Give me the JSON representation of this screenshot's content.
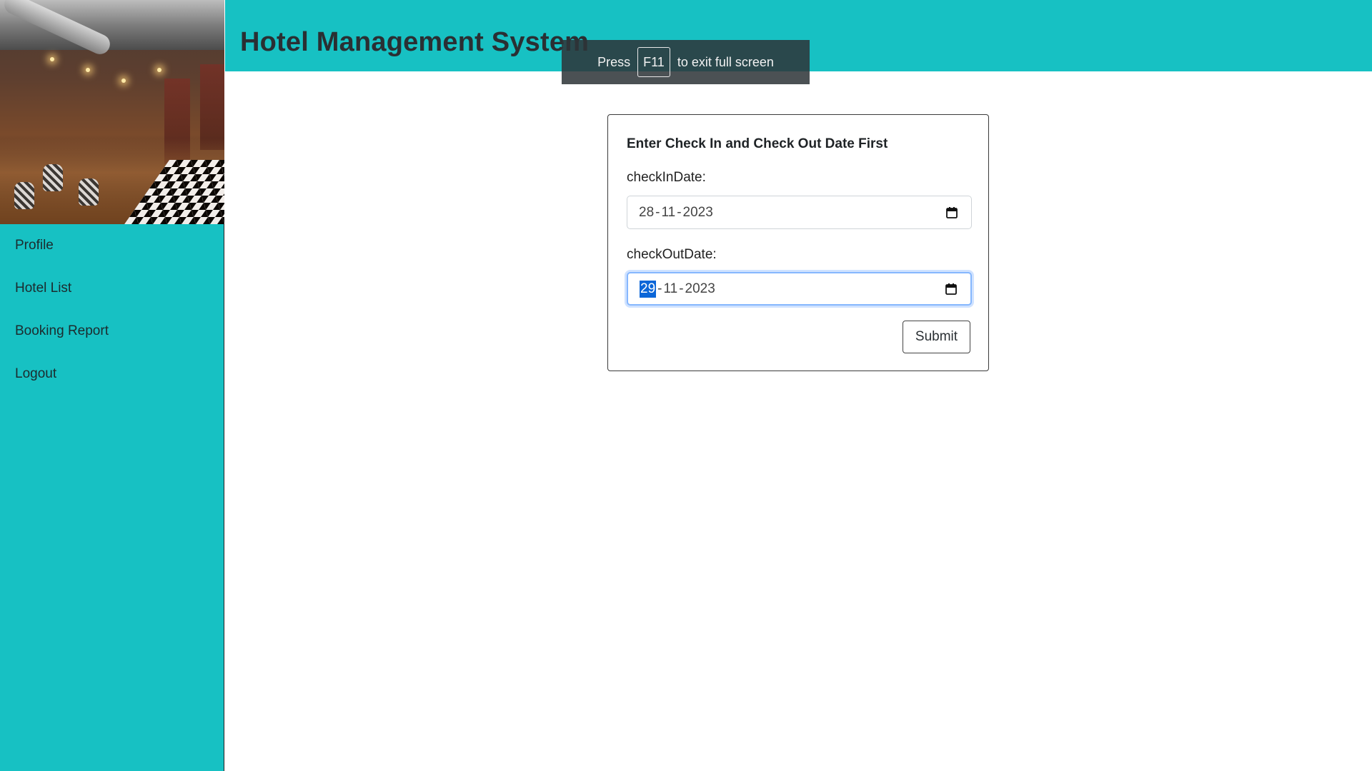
{
  "header": {
    "title": "Hotel Management System"
  },
  "sidebar": {
    "items": [
      {
        "label": "Profile"
      },
      {
        "label": "Hotel List"
      },
      {
        "label": "Booking Report"
      },
      {
        "label": "Logout"
      }
    ]
  },
  "fullscreen_toast": {
    "prefix": "Press",
    "key": "F11",
    "suffix": "to exit full screen"
  },
  "form": {
    "title": "Enter Check In and Check Out Date First",
    "check_in": {
      "label": "checkInDate:",
      "day": "28",
      "month": "11",
      "year": "2023"
    },
    "check_out": {
      "label": "checkOutDate:",
      "day": "29",
      "month": "11",
      "year": "2023"
    },
    "submit_label": "Submit"
  },
  "colors": {
    "accent": "#17c1c3",
    "focus": "#86b7fe",
    "selection": "#0b66d8"
  },
  "icons": {
    "calendar": "calendar-icon"
  }
}
